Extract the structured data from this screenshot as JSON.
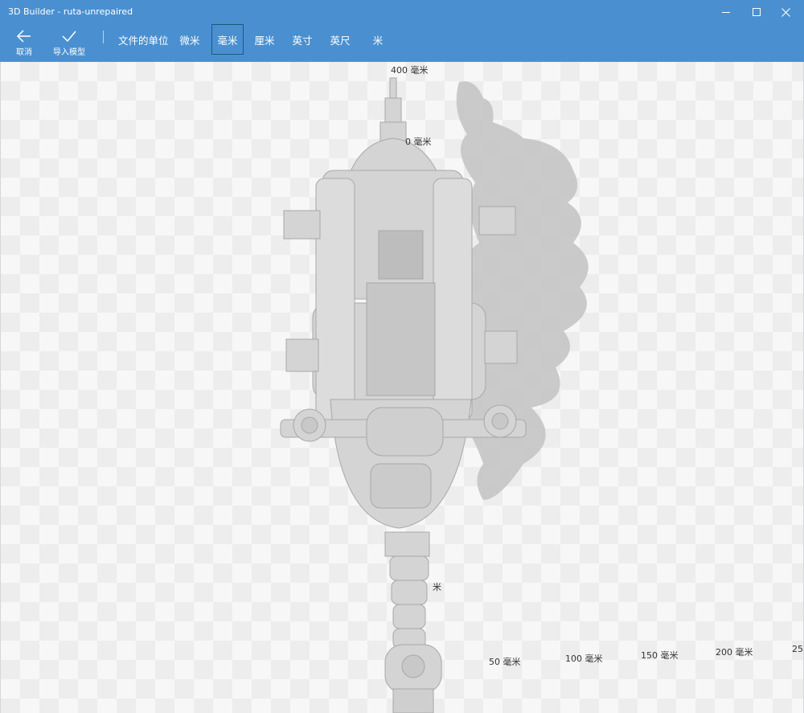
{
  "window": {
    "title": "3D Builder - ruta-unrepaired"
  },
  "toolbar": {
    "cancel_label": "取消",
    "import_label": "导入模型",
    "units_caption": "文件的单位",
    "units": [
      {
        "label": "微米",
        "selected": false
      },
      {
        "label": "毫米",
        "selected": true
      },
      {
        "label": "厘米",
        "selected": false
      },
      {
        "label": "英寸",
        "selected": false
      },
      {
        "label": "英尺",
        "selected": false
      },
      {
        "label": "米",
        "selected": false
      }
    ]
  },
  "viewport": {
    "scale_labels": [
      "400 毫米",
      "0 毫米",
      "米",
      "50 毫米",
      "100 毫米",
      "150 毫米",
      "200 毫米",
      "25"
    ]
  },
  "colors": {
    "titlebar": "#4a90d0",
    "selected_border": "#1c5a7a",
    "model_fill": "#d4d4d4",
    "shadow_fill": "#c2c2c2"
  }
}
